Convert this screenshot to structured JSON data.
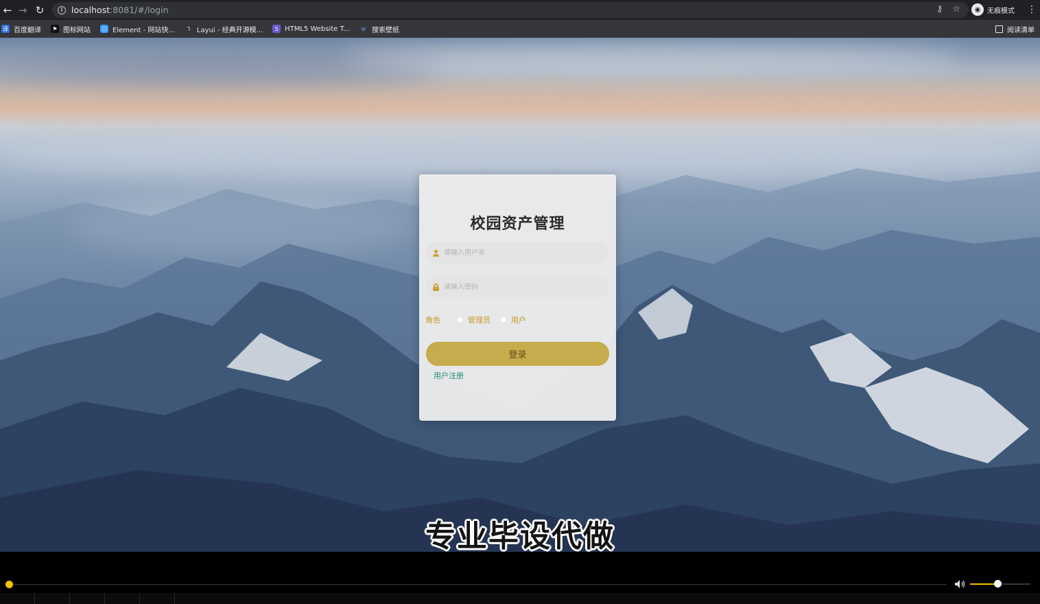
{
  "browser": {
    "url_host": "localhost",
    "url_rest": ":8081/#/login",
    "incognito_label": "无痕模式",
    "bookmarks": [
      {
        "label": "百度翻译",
        "icon": "translate-icon",
        "color": "#2f6fd6"
      },
      {
        "label": "图标网站",
        "icon": "flag-icon",
        "color": "#222222"
      },
      {
        "label": "Element - 网站快...",
        "icon": "element-hexagon-icon",
        "color": "#409eff"
      },
      {
        "label": "Layui - 经典开源模...",
        "icon": "layui-icon",
        "color": "#333333"
      },
      {
        "label": "HTML5 Website T...",
        "icon": "html5-icon",
        "color": "#6a5acd"
      },
      {
        "label": "搜索壁纸",
        "icon": "wallpaper-icon",
        "color": "#3a7bd5"
      }
    ],
    "reading_list_label": "阅读清单"
  },
  "login": {
    "title": "校园资产管理",
    "username_placeholder": "请输入用户名",
    "password_placeholder": "请输入密码",
    "role_label": "角色",
    "role_options": [
      "管理员",
      "用户"
    ],
    "login_button": "登录",
    "register_link": "用户注册"
  },
  "caption": "专业毕设代做",
  "player": {
    "progress": 0.0,
    "volume": 0.45,
    "accent_color": "#f2c200"
  }
}
